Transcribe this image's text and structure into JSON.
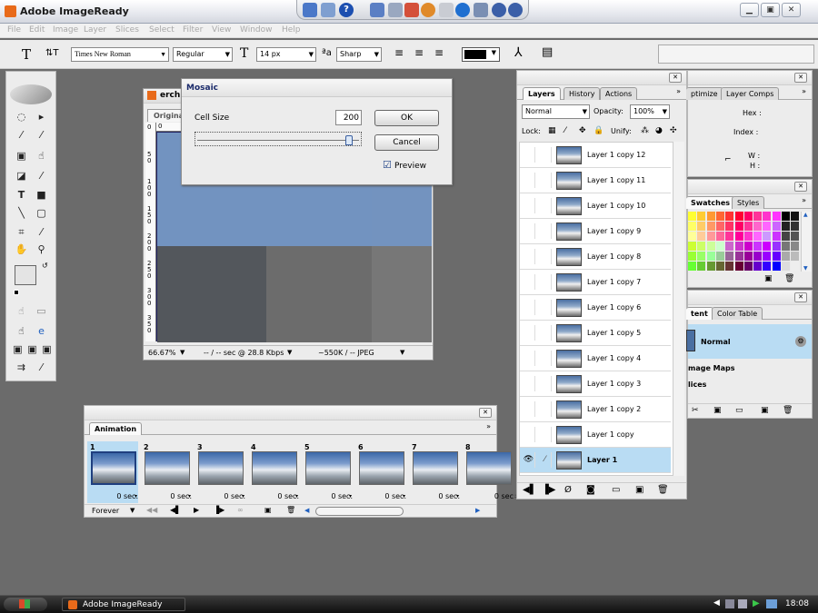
{
  "app": {
    "title": "Adobe ImageReady"
  },
  "menu": [
    "File",
    "Edit",
    "Image",
    "Layer",
    "Slices",
    "Select",
    "Filter",
    "View",
    "Window",
    "Help"
  ],
  "options": {
    "tool_glyph": "T",
    "orientation_glyph": "⇅T",
    "font_family": "Times New Roman",
    "font_style": "Regular",
    "size_glyph": "T",
    "font_size": "14 px",
    "aa_label": "ªa",
    "antialias": "Sharp",
    "text_color": "#000000"
  },
  "document": {
    "title": "erch",
    "view_tab": "Origina",
    "zoom": "66.67%",
    "download": "-- / -- sec @ 28.8 Kbps",
    "size_info": "~550K / -- JPEG",
    "ruler_v": [
      "0",
      "5\n0",
      "1\n0\n0",
      "1\n5\n0",
      "2\n0\n0",
      "2\n5\n0",
      "3\n0\n0",
      "3\n5\n0"
    ],
    "ruler_h": [
      "0"
    ],
    "tiles": [
      "#7293c0",
      "#7293c0",
      "#7393bf",
      "#53575c",
      "#6c6c6c",
      "#777777"
    ]
  },
  "mosaic": {
    "title": "Mosaic",
    "cell_size_label": "Cell Size",
    "cell_size_value": "200",
    "slider_fraction": 0.97,
    "ok_label": "OK",
    "cancel_label": "Cancel",
    "preview_label": "Preview",
    "preview_checked": "☑"
  },
  "layers_panel": {
    "tabs": [
      "Layers",
      "History",
      "Actions"
    ],
    "blend_mode": "Normal",
    "opacity_label": "Opacity:",
    "opacity_value": "100%",
    "lock_label": "Lock:",
    "unify_label": "Unify:",
    "layers": [
      {
        "name": "Layer 1 copy 12"
      },
      {
        "name": "Layer 1 copy 11"
      },
      {
        "name": "Layer 1 copy 10"
      },
      {
        "name": "Layer 1 copy 9"
      },
      {
        "name": "Layer 1 copy 8"
      },
      {
        "name": "Layer 1 copy 7"
      },
      {
        "name": "Layer 1 copy 6"
      },
      {
        "name": "Layer 1 copy 5"
      },
      {
        "name": "Layer 1 copy 4"
      },
      {
        "name": "Layer 1 copy 3"
      },
      {
        "name": "Layer 1 copy 2"
      },
      {
        "name": "Layer 1 copy"
      },
      {
        "name": "Layer 1",
        "selected": true
      }
    ]
  },
  "optimize_panel": {
    "tabs": [
      "Optimize",
      "Layer Comps"
    ],
    "tab_visible": [
      "ptimize",
      "Layer Comps"
    ],
    "hex_label": "Hex :",
    "index_label": "Index :",
    "w_label": "W :",
    "h_label": "H :"
  },
  "swatches_panel": {
    "tabs": [
      "Swatches",
      "Styles"
    ]
  },
  "content_panel": {
    "tabs": [
      "tent",
      "Color Table"
    ],
    "mode": "Normal",
    "items": [
      "mage Maps",
      "lices"
    ]
  },
  "animation": {
    "tab": "Animation",
    "loop": "Forever",
    "frames": [
      {
        "num": "1",
        "delay": "0 sec."
      },
      {
        "num": "2",
        "delay": "0 sec."
      },
      {
        "num": "3",
        "delay": "0 sec."
      },
      {
        "num": "4",
        "delay": "0 sec."
      },
      {
        "num": "5",
        "delay": "0 sec."
      },
      {
        "num": "6",
        "delay": "0 sec."
      },
      {
        "num": "7",
        "delay": "0 sec."
      },
      {
        "num": "8",
        "delay": "0 sec"
      }
    ]
  },
  "taskbar": {
    "window_label": "Adobe ImageReady",
    "clock": "18:08"
  },
  "colors": {
    "selection": "#b9dcf3",
    "accent_blue": "#1f5fbf"
  }
}
